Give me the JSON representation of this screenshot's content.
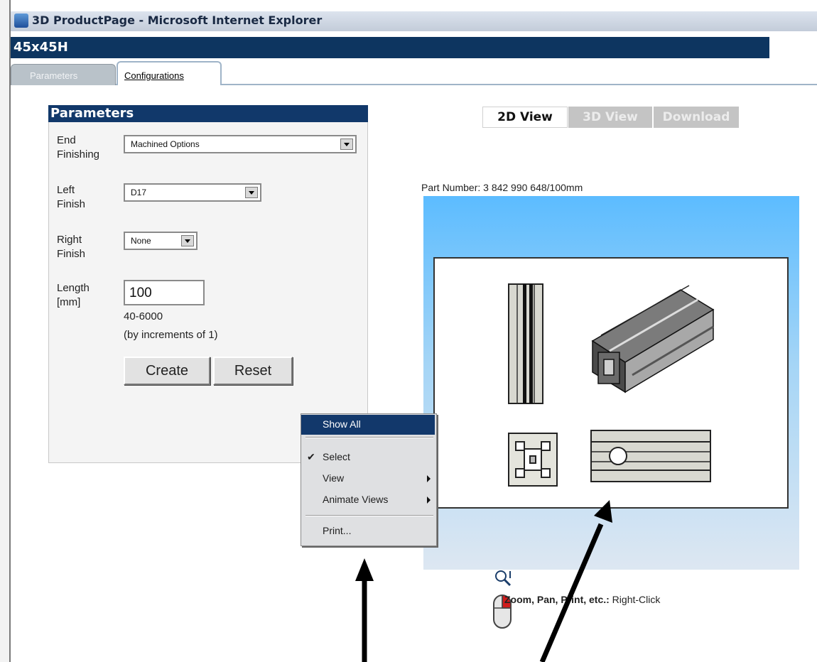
{
  "window": {
    "title": "3D ProductPage - Microsoft Internet Explorer"
  },
  "header": {
    "product": "45x45H"
  },
  "tabs": [
    {
      "label": "Parameters",
      "active": false
    },
    {
      "label": "Configurations",
      "active": true
    }
  ],
  "parameters": {
    "title": "Parameters",
    "end_finishing": {
      "label_line1": "End",
      "label_line2": "Finishing",
      "value": "Machined Options"
    },
    "left_finish": {
      "label_line1": "Left",
      "label_line2": "Finish",
      "value": "D17"
    },
    "right_finish": {
      "label_line1": "Right",
      "label_line2": "Finish",
      "value": "None"
    },
    "length": {
      "label_line1": "Length",
      "label_line2": "[mm]",
      "value": "100",
      "range": "40-6000",
      "increment": "(by increments of 1)"
    },
    "create_label": "Create",
    "reset_label": "Reset"
  },
  "view_tabs": [
    "2D View",
    "3D View",
    "Download"
  ],
  "part_number": "Part Number: 3 842 990 648/100mm",
  "context_menu": {
    "show_all": "Show All",
    "select": "Select",
    "view": "View",
    "animate_views": "Animate Views",
    "print": "Print..."
  },
  "hint": {
    "bold": "Zoom, Pan, Print, etc.:",
    "text": " Right-Click"
  },
  "colors": {
    "header_bg": "#0d3560",
    "menu_highlight": "#12386b",
    "viewer_sky": "#5cbcff"
  }
}
